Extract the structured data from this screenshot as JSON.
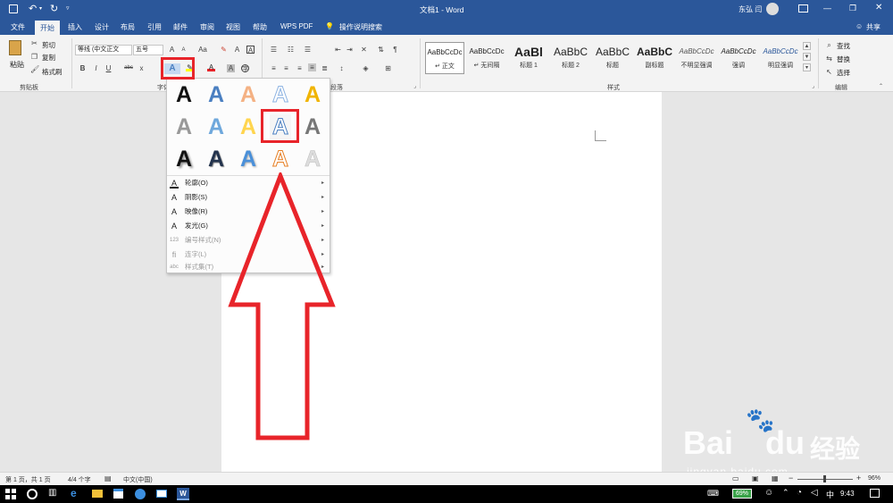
{
  "window": {
    "title": "文档1 - Word",
    "user": "东弘 闫",
    "share": "共享"
  },
  "menu": {
    "tabs": [
      "文件",
      "开始",
      "插入",
      "设计",
      "布局",
      "引用",
      "邮件",
      "审阅",
      "视图",
      "帮助",
      "WPS PDF"
    ],
    "tell_me": "操作说明搜索"
  },
  "clipboard": {
    "paste": "粘贴",
    "cut": "剪切",
    "copy": "复制",
    "format_painter": "格式刷",
    "group": "剪贴板"
  },
  "font": {
    "name": "等线 (中文正文",
    "size": "五号",
    "group": "字体",
    "bold": "B",
    "italic": "I",
    "underline": "U",
    "strike": "abc",
    "sub": "x",
    "grow": "A",
    "shrink": "A",
    "case": "Aa",
    "phonetic": "A",
    "border": "A"
  },
  "paragraph": {
    "group": "段落"
  },
  "styles": {
    "group": "样式",
    "items": [
      {
        "sample": "AaBbCcDc",
        "name": "↵ 正文"
      },
      {
        "sample": "AaBbCcDc",
        "name": "↵ 无间隔"
      },
      {
        "sample": "AaBl",
        "name": "标题 1"
      },
      {
        "sample": "AaBbC",
        "name": "标题 2"
      },
      {
        "sample": "AaBbC",
        "name": "标题"
      },
      {
        "sample": "AaBbC",
        "name": "副标题"
      },
      {
        "sample": "AaBbCcDc",
        "name": "不明显强调"
      },
      {
        "sample": "AaBbCcDc",
        "name": "强调"
      },
      {
        "sample": "AaBbCcDc",
        "name": "明显强调"
      }
    ]
  },
  "editing": {
    "find": "查找",
    "replace": "替换",
    "select": "选择",
    "group": "编辑"
  },
  "text_effects": {
    "gallery": [
      "A",
      "A",
      "A",
      "A",
      "A",
      "A",
      "A",
      "A",
      "A",
      "A",
      "A",
      "A",
      "A",
      "A",
      "A"
    ],
    "menu": [
      {
        "label": "轮廓(O)",
        "disabled": false
      },
      {
        "label": "阴影(S)",
        "disabled": false
      },
      {
        "label": "映像(R)",
        "disabled": false
      },
      {
        "label": "发光(G)",
        "disabled": false
      },
      {
        "label": "编号样式(N)",
        "disabled": true
      },
      {
        "label": "连字(L)",
        "disabled": true
      },
      {
        "label": "样式集(T)",
        "disabled": true
      }
    ]
  },
  "status": {
    "page": "第 1 页，共 1 页",
    "words": "4/4 个字",
    "lang": "中文(中国)",
    "zoom": "96%",
    "minus": "−",
    "plus": "+"
  },
  "taskbar": {
    "battery": "69%",
    "lang": "中",
    "time": "9:43"
  },
  "watermark": {
    "brand": "Bai",
    "brand2": "du",
    "cn": "经验",
    "url": "jingyan.baidu.com"
  },
  "colors": {
    "accent": "#2b579a",
    "highlight": "#e8242a"
  }
}
